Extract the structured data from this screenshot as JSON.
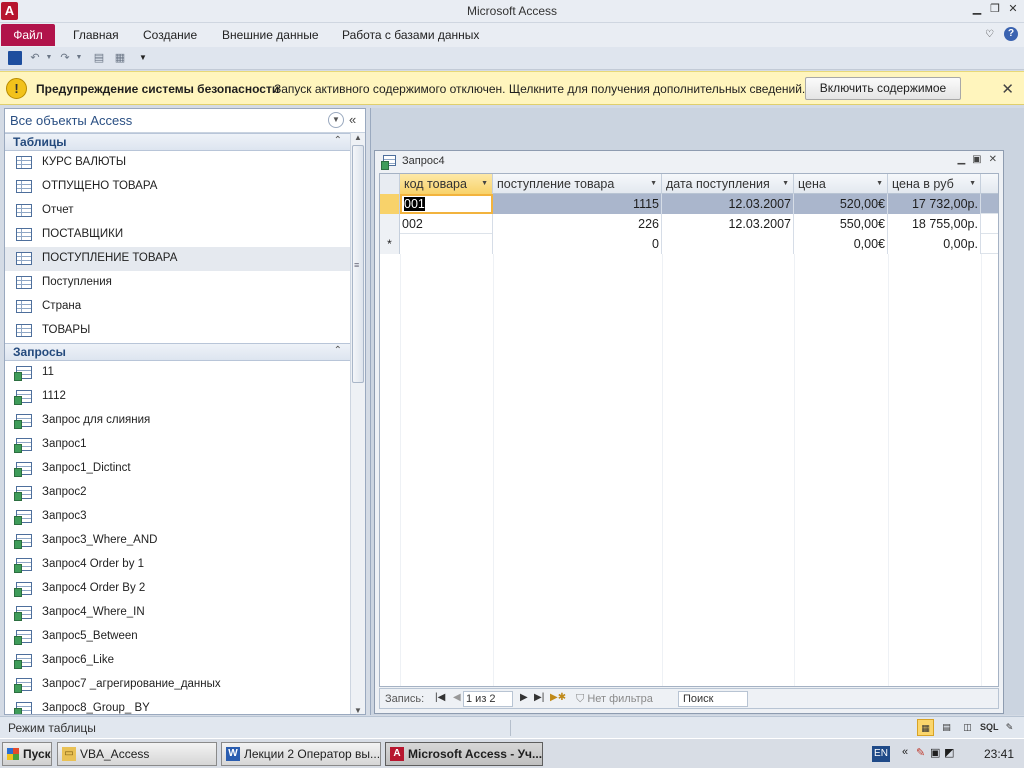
{
  "window": {
    "title": "Microsoft Access",
    "app_icon": "A"
  },
  "ribbon": {
    "file": "Файл",
    "tabs": [
      "Главная",
      "Создание",
      "Внешние данные",
      "Работа с базами данных"
    ]
  },
  "security": {
    "title": "Предупреждение системы безопасности",
    "message": "Запуск активного содержимого отключен. Щелкните для получения дополнительных сведений.",
    "button": "Включить содержимое",
    "close": "✕"
  },
  "nav": {
    "header": "Все объекты Access",
    "groups": [
      {
        "label": "Таблицы",
        "type": "table",
        "items": [
          "КУРС ВАЛЮТЫ",
          "ОТПУЩЕНО ТОВАРА",
          "Отчет",
          "ПОСТАВЩИКИ",
          "ПОСТУПЛЕНИЕ ТОВАРА",
          "Поступления",
          "Страна",
          "ТОВАРЫ"
        ]
      },
      {
        "label": "Запросы",
        "type": "query",
        "items": [
          "11",
          "1112",
          "Запрос для слияния",
          "Запрос1",
          "Запрос1_Dictinct",
          "Запрос2",
          "Запрос3",
          "Запрос3_Where_AND",
          "Запрос4 Order by 1",
          "Запрос4 Order By 2",
          "Запрос4_Where_IN",
          "Запрос5_Between",
          "Запрос6_Like",
          "Запрос7 _агрегирование_данных",
          "Запрос8_Group_ BY"
        ]
      }
    ],
    "selected_item": "ПОСТУПЛЕНИЕ ТОВАРА"
  },
  "query_window": {
    "title": "Запрос4",
    "columns": [
      "код товара",
      "поступление товара",
      "дата поступления",
      "цена",
      "цена в руб"
    ],
    "rows": [
      [
        "001",
        "1115",
        "12.03.2007",
        "520,00€",
        "17 732,00р."
      ],
      [
        "002",
        "226",
        "12.03.2007",
        "550,00€",
        "18 755,00р."
      ]
    ],
    "new_row": [
      "",
      "0",
      "",
      "0,00€",
      "0,00р."
    ],
    "new_row_marker": "*",
    "navigation": {
      "label": "Запись:",
      "record": "1 из 2",
      "filter": "Нет фильтра",
      "search": "Поиск"
    }
  },
  "status": {
    "text": "Режим таблицы",
    "views": [
      "datasheet",
      "pivot-table",
      "pivot-chart",
      "SQL",
      "design"
    ]
  },
  "taskbar": {
    "start": "Пуск",
    "buttons": [
      {
        "label": "VBA_Access",
        "icon": "folder-icon",
        "active": false
      },
      {
        "label": "Лекции 2 Оператор вы...",
        "icon": "word-icon",
        "active": false
      },
      {
        "label": "Microsoft Access - Уч...",
        "icon": "access-icon",
        "active": true
      }
    ],
    "lang": "EN",
    "clock": "23:41"
  }
}
